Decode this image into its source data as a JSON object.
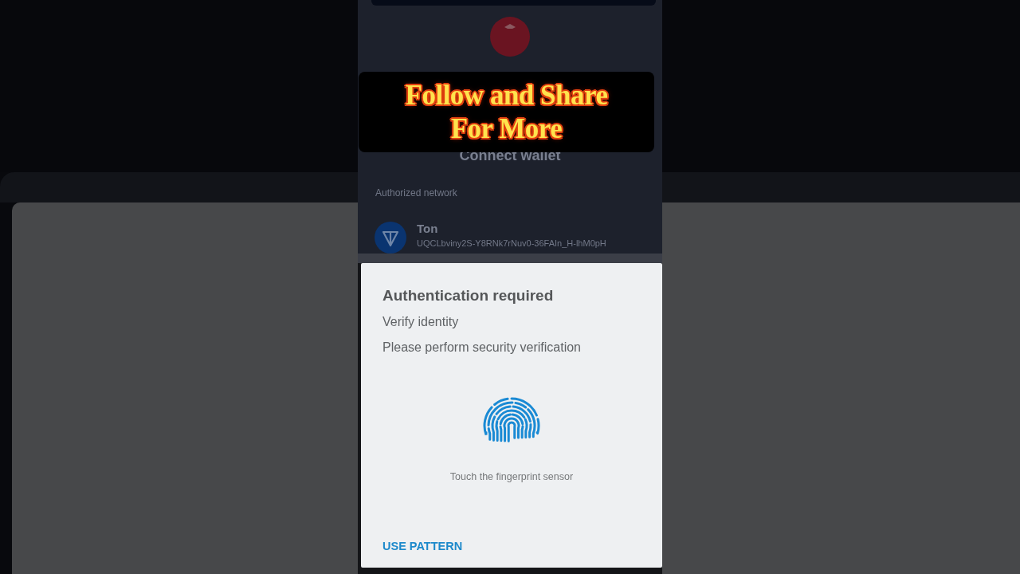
{
  "app": {
    "title": "Connect wallet",
    "section_label": "Authorized network",
    "networks": [
      {
        "name": "Ton",
        "address": "UQCLbviny2S-Y8RNk7rNuv0-36FAIn_H-lhM0pH"
      }
    ]
  },
  "caption": {
    "lines": [
      "Follow and Share",
      "For More"
    ]
  },
  "dialog": {
    "title": "Authentication required",
    "subtitle": "Verify identity",
    "message": "Please perform security verification",
    "sensor_hint": "Touch the fingerprint sensor",
    "button": "USE PATTERN"
  }
}
